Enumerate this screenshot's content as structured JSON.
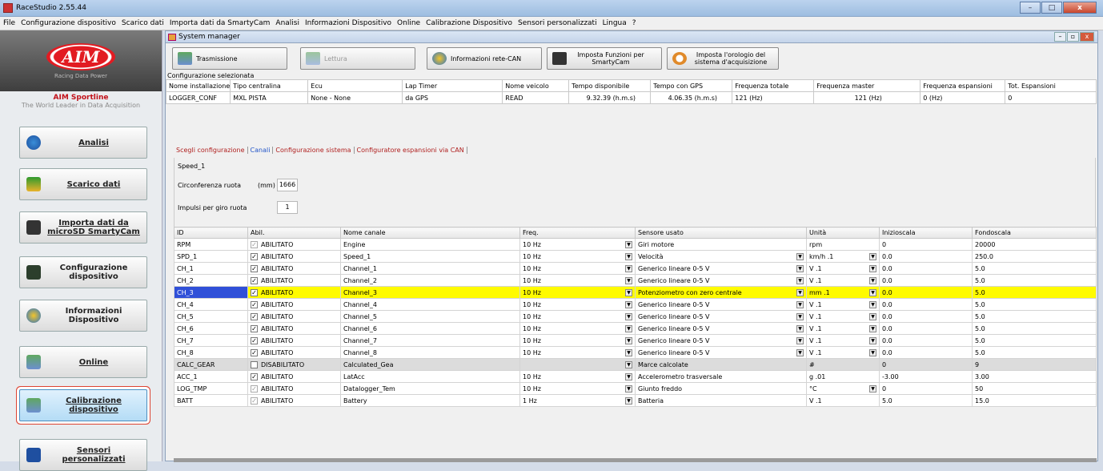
{
  "window": {
    "title": "RaceStudio 2.55.44",
    "controls": [
      "–",
      "□",
      "x"
    ]
  },
  "menu": [
    "File",
    "Configurazione dispositivo",
    "Scarico dati",
    "Importa dati da SmartyCam",
    "Analisi",
    "Informazioni Dispositivo",
    "Online",
    "Calibrazione Dispositivo",
    "Sensori personalizzati",
    "Lingua",
    "?"
  ],
  "sidebar": {
    "logo": "AIM",
    "logo_sub": "Racing Data Power",
    "brand": "AIM Sportline",
    "tagline": "The World Leader in Data Acquisition",
    "buttons": [
      {
        "label": "Analisi"
      },
      {
        "label": "Scarico dati"
      },
      {
        "label": "Importa dati da microSD SmartyCam"
      },
      {
        "label": "Configurazione dispositivo"
      },
      {
        "label": "Informazioni Dispositivo"
      },
      {
        "label": "Online"
      },
      {
        "label": "Calibrazione dispositivo"
      },
      {
        "label": "Sensori personalizzati"
      }
    ]
  },
  "child": {
    "title": "System manager",
    "toolbar": [
      {
        "label": "Trasmissione"
      },
      {
        "label": "Lettura"
      },
      {
        "label": "Informazioni rete-CAN"
      },
      {
        "label": "Imposta Funzioni per SmartyCam"
      },
      {
        "label": "Imposta l'orologio del sistema d'acquisizione"
      }
    ]
  },
  "config": {
    "caption": "Configurazione selezionata",
    "headers": [
      "Nome installazione",
      "Tipo centralina",
      "Ecu",
      "Lap Timer",
      "Nome veicolo",
      "Tempo disponibile",
      "Tempo con GPS",
      "Frequenza totale",
      "Frequenza master",
      "Frequenza espansioni",
      "Tot. Espansioni"
    ],
    "values": [
      "LOGGER_CONF",
      "MXL PISTA",
      "None - None",
      "da GPS",
      "READ",
      "9.32.39 (h.m.s)",
      "4.06.35 (h.m.s)",
      "121 (Hz)",
      "121 (Hz)",
      "0 (Hz)",
      "0"
    ]
  },
  "tabs": [
    "Scegli configurazione",
    "Canali",
    "Configurazione sistema",
    "Configuratore espansioni via CAN"
  ],
  "speed": {
    "name": "Speed_1",
    "circ_label": "Circonferenza ruota",
    "circ_unit": "(mm)",
    "circ_value": "1666",
    "imp_label": "Impulsi per giro ruota",
    "imp_value": "1"
  },
  "grid": {
    "headers": [
      "ID",
      "Abil.",
      "Nome canale",
      "Freq.",
      "Sensore usato",
      "Unità",
      "Inizioscala",
      "Fondoscala"
    ],
    "rows": [
      [
        "RPM",
        "ABILITATO",
        "Engine",
        "10 Hz",
        "Giri motore",
        "rpm",
        "0",
        "20000"
      ],
      [
        "SPD_1",
        "ABILITATO",
        "Speed_1",
        "10 Hz",
        "Velocità",
        "km/h .1",
        "0.0",
        "250.0"
      ],
      [
        "CH_1",
        "ABILITATO",
        "Channel_1",
        "10 Hz",
        "Generico lineare 0-5 V",
        "V .1",
        "0.0",
        "5.0"
      ],
      [
        "CH_2",
        "ABILITATO",
        "Channel_2",
        "10 Hz",
        "Generico lineare 0-5 V",
        "V .1",
        "0.0",
        "5.0"
      ],
      [
        "CH_3",
        "ABILITATO",
        "Channel_3",
        "10 Hz",
        "Potenziometro con zero centrale",
        "mm .1",
        "0.0",
        "5.0"
      ],
      [
        "CH_4",
        "ABILITATO",
        "Channel_4",
        "10 Hz",
        "Generico lineare 0-5 V",
        "V .1",
        "0.0",
        "5.0"
      ],
      [
        "CH_5",
        "ABILITATO",
        "Channel_5",
        "10 Hz",
        "Generico lineare 0-5 V",
        "V .1",
        "0.0",
        "5.0"
      ],
      [
        "CH_6",
        "ABILITATO",
        "Channel_6",
        "10 Hz",
        "Generico lineare 0-5 V",
        "V .1",
        "0.0",
        "5.0"
      ],
      [
        "CH_7",
        "ABILITATO",
        "Channel_7",
        "10 Hz",
        "Generico lineare 0-5 V",
        "V .1",
        "0.0",
        "5.0"
      ],
      [
        "CH_8",
        "ABILITATO",
        "Channel_8",
        "10 Hz",
        "Generico lineare 0-5 V",
        "V .1",
        "0.0",
        "5.0"
      ],
      [
        "CALC_GEAR",
        "DISABILITATO",
        "Calculated_Gea",
        "",
        "Marce calcolate",
        "#",
        "0",
        "9"
      ],
      [
        "ACC_1",
        "ABILITATO",
        "LatAcc",
        "10 Hz",
        "Accelerometro trasversale",
        "g .01",
        "-3.00",
        "3.00"
      ],
      [
        "LOG_TMP",
        "ABILITATO",
        "Datalogger_Tem",
        "10 Hz",
        "Giunto freddo",
        "°C",
        "0",
        "50"
      ],
      [
        "BATT",
        "ABILITATO",
        "Battery",
        "1 Hz",
        "Batteria",
        "V .1",
        "5.0",
        "15.0"
      ]
    ]
  }
}
